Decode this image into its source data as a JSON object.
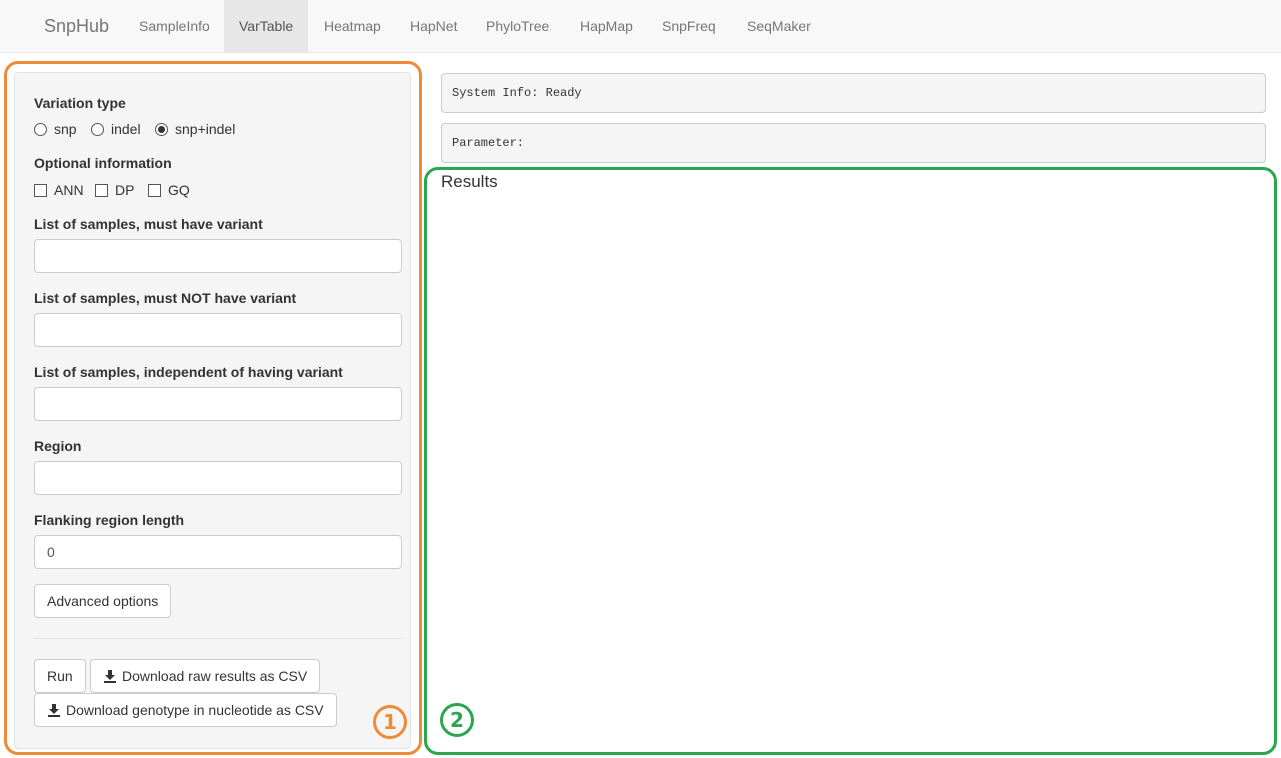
{
  "navbar": {
    "brand": "SnpHub",
    "tabs": [
      {
        "label": "SampleInfo"
      },
      {
        "label": "VarTable",
        "active": true
      },
      {
        "label": "Heatmap"
      },
      {
        "label": "HapNet"
      },
      {
        "label": "PhyloTree"
      },
      {
        "label": "HapMap"
      },
      {
        "label": "SnpFreq"
      },
      {
        "label": "SeqMaker"
      }
    ]
  },
  "sidebar": {
    "variation_type": {
      "label": "Variation type",
      "options": [
        "snp",
        "indel",
        "snp+indel"
      ],
      "selected": "snp+indel"
    },
    "optional_info": {
      "label": "Optional information",
      "options": [
        "ANN",
        "DP",
        "GQ"
      ]
    },
    "must_have": {
      "label": "List of samples, must have variant",
      "value": ""
    },
    "must_not_have": {
      "label": "List of samples, must NOT have variant",
      "value": ""
    },
    "independent": {
      "label": "List of samples, independent of having variant",
      "value": ""
    },
    "region": {
      "label": "Region",
      "value": ""
    },
    "flanking": {
      "label": "Flanking region length",
      "value": "0"
    },
    "advanced_button": "Advanced options",
    "run_button": "Run",
    "download_raw_button": "Download raw results as CSV",
    "download_genotype_button": "Download genotype in nucleotide as CSV"
  },
  "main": {
    "system_info": "System Info: Ready",
    "parameter": "Parameter:",
    "results_title": "Results"
  },
  "annotations": {
    "badge_1": "1",
    "badge_2": "2",
    "orange": "#ef8a37",
    "green": "#2aa64d"
  }
}
